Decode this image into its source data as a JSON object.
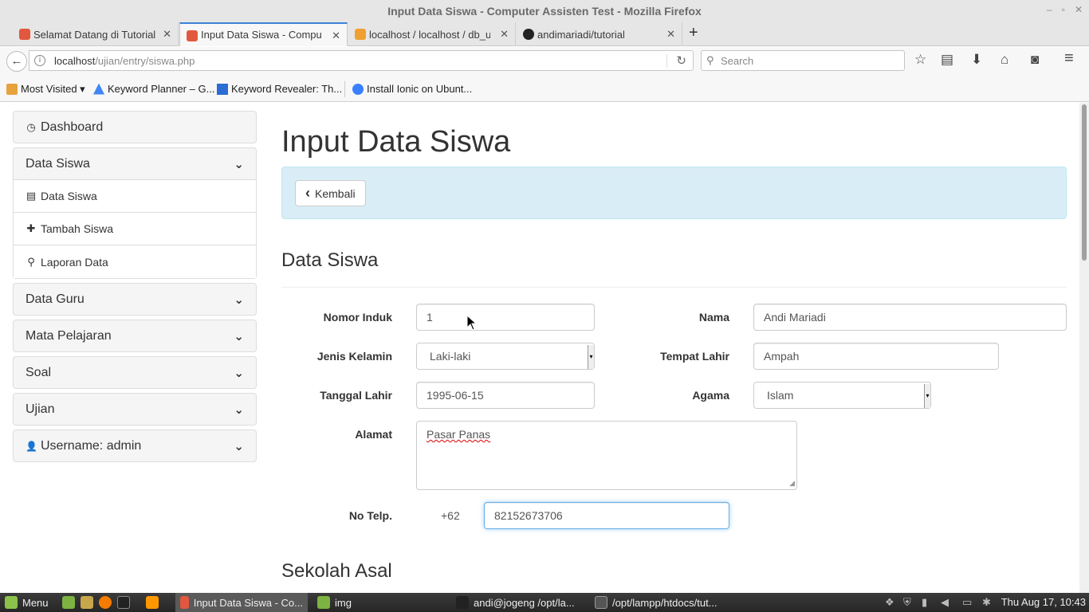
{
  "window": {
    "title": "Input Data Siswa - Computer Assisten Test - Mozilla Firefox",
    "controls": [
      "–",
      "▫",
      "✕"
    ]
  },
  "tabs": [
    {
      "label": "Selamat Datang di Tutorial",
      "active": false
    },
    {
      "label": "Input Data Siswa - Compute",
      "active": true
    },
    {
      "label": "localhost / localhost / db_uji",
      "active": false
    },
    {
      "label": "andimariadi/tutorial",
      "active": false
    }
  ],
  "tab_close": "✕",
  "new_tab": "+",
  "nav": {
    "back": "←",
    "url_host": "localhost",
    "url_path": "/ujian/entry/siswa.php",
    "reload": "↻",
    "search_placeholder": "Search",
    "icons": {
      "bookmark_star": "☆",
      "reading_list": "▤",
      "download": "⬇",
      "home": "⌂",
      "pocket": "◙",
      "menu": "≡"
    }
  },
  "bookmarks": [
    {
      "label": "Most Visited ▾"
    },
    {
      "label": "Keyword Planner – G..."
    },
    {
      "label": "Keyword Revealer: Th..."
    },
    {
      "label": "Install Ionic on Ubunt..."
    }
  ],
  "sidebar": {
    "dashboard": {
      "label": "Dashboard",
      "icon": "◷"
    },
    "data_siswa": {
      "label": "Data Siswa",
      "chevron": "⌄",
      "items": [
        {
          "label": "Data Siswa",
          "icon": "▤"
        },
        {
          "label": "Tambah Siswa",
          "icon": "✚"
        },
        {
          "label": "Laporan Data",
          "icon": "⚲"
        }
      ]
    },
    "data_guru": {
      "label": "Data Guru"
    },
    "mata_pelajaran": {
      "label": "Mata Pelajaran"
    },
    "soal": {
      "label": "Soal"
    },
    "ujian": {
      "label": "Ujian"
    },
    "username": {
      "label": "Username: admin",
      "icon": "👤"
    }
  },
  "main": {
    "page_title": "Input Data Siswa",
    "back_button": "Kembali",
    "back_icon": "‹",
    "section_data_siswa": "Data Siswa",
    "section_sekolah_asal": "Sekolah Asal",
    "form": {
      "nomor_induk": {
        "label": "Nomor Induk",
        "value": "1"
      },
      "nama": {
        "label": "Nama",
        "value": "Andi Mariadi"
      },
      "jenis_kelamin": {
        "label": "Jenis Kelamin",
        "value": "Laki-laki"
      },
      "tempat_lahir": {
        "label": "Tempat Lahir",
        "value": "Ampah"
      },
      "tanggal_lahir": {
        "label": "Tanggal Lahir",
        "value": "1995-06-15"
      },
      "agama": {
        "label": "Agama",
        "value": "Islam"
      },
      "alamat": {
        "label": "Alamat",
        "value": "Pasar Panas"
      },
      "no_telp": {
        "label": "No Telp.",
        "prefix": "+62",
        "value": "82152673706"
      }
    }
  },
  "taskbar": {
    "menu": "Menu",
    "tasks": [
      {
        "label": "Input Data Siswa - Co...",
        "active": true
      },
      {
        "label": "img",
        "active": false
      },
      {
        "label": "andi@jogeng /opt/la...",
        "active": false
      },
      {
        "label": "/opt/lampp/htdocs/tut...",
        "active": false
      }
    ],
    "clock": "Thu Aug 17, 10:43"
  },
  "colors": {
    "alert_bg": "#d9edf7",
    "tab_accent": "#3b82d6",
    "focus_border": "#66afe9"
  }
}
